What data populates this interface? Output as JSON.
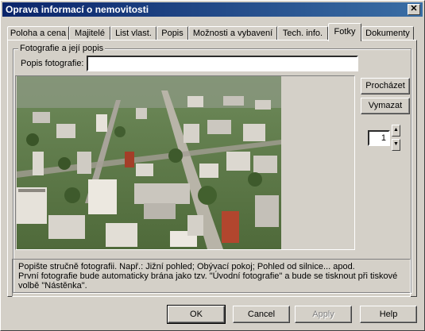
{
  "window": {
    "title": "Oprava informací o nemovitosti",
    "close_glyph": "✕"
  },
  "tabs": [
    {
      "label": "Poloha a cena",
      "active": false
    },
    {
      "label": "Majitelé",
      "active": false
    },
    {
      "label": "List vlast.",
      "active": false
    },
    {
      "label": "Popis",
      "active": false
    },
    {
      "label": "Možnosti a vybavení",
      "active": false
    },
    {
      "label": "Tech. info.",
      "active": false
    },
    {
      "label": "Fotky",
      "active": true
    },
    {
      "label": "Dokumenty",
      "active": false
    }
  ],
  "photo_group": {
    "title": "Fotografie a její popis",
    "caption_label": "Popis fotografie:",
    "caption_value": "",
    "browse_label": "Procházet",
    "delete_label": "Vymazat",
    "photo_index": "1",
    "spin_up_glyph": "▲",
    "spin_down_glyph": "▼",
    "photo_icon": "aerial-city-photo"
  },
  "help": {
    "line1": "Popište stručně fotografii. Např.: Jižní pohled; Obývací pokoj; Pohled od silnice... apod.",
    "line2": "První fotografie bude automaticky brána jako tzv. \"Úvodní fotografie\" a bude se tisknout při tiskové",
    "line3": "volbě \"Nástěnka\"."
  },
  "footer": {
    "ok_label": "OK",
    "cancel_label": "Cancel",
    "apply_label": "Apply",
    "help_label": "Help"
  },
  "colors": {
    "title_bar": "#0a246a",
    "face": "#d4d0c8"
  }
}
